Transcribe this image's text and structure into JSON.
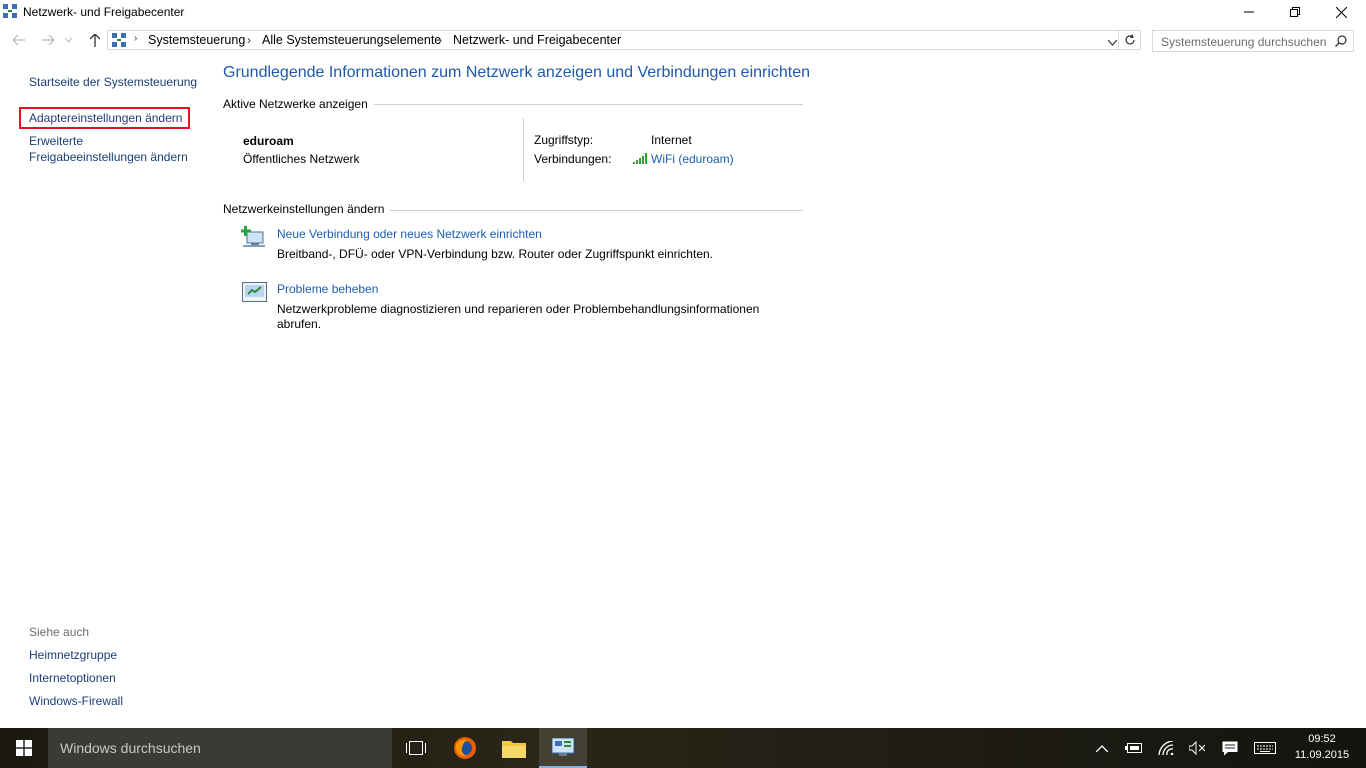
{
  "window": {
    "title": "Netzwerk- und Freigabecenter"
  },
  "address": {
    "crumbs": [
      "Systemsteuerung",
      "Alle Systemsteuerungselemente",
      "Netzwerk- und Freigabecenter"
    ],
    "search_placeholder": "Systemsteuerung durchsuchen"
  },
  "left_pane": {
    "home": "Startseite der Systemsteuerung",
    "adapter": "Adaptereinstellungen ändern",
    "advanced_line1": "Erweiterte",
    "advanced_line2": "Freigabeeinstellungen ändern",
    "see_also": "Siehe auch",
    "see_also_links": [
      "Heimnetzgruppe",
      "Internetoptionen",
      "Windows-Firewall"
    ]
  },
  "main": {
    "title": "Grundlegende Informationen zum Netzwerk anzeigen und Verbindungen einrichten",
    "active_label": "Aktive Netzwerke anzeigen",
    "network_name": "eduroam",
    "network_type": "Öffentliches Netzwerk",
    "access_type_label": "Zugriffstyp:",
    "access_type_value": "Internet",
    "connections_label": "Verbindungen:",
    "connection_value": "WiFi (eduroam)",
    "change_label": "Netzwerkeinstellungen ändern",
    "task1_title": "Neue Verbindung oder neues Netzwerk einrichten",
    "task1_desc": "Breitband-, DFÜ- oder VPN-Verbindung bzw. Router oder Zugriffspunkt einrichten.",
    "task2_title": "Probleme beheben",
    "task2_desc1": "Netzwerkprobleme diagnostizieren und reparieren oder Problembehandlungsinformationen",
    "task2_desc2": "abrufen."
  },
  "taskbar": {
    "search_placeholder": "Windows durchsuchen",
    "time": "09:52",
    "date": "11.09.2015"
  },
  "colors": {
    "accent_link": "#1a5fb4",
    "title_blue": "#1e5aa8",
    "highlight_red": "#e81123"
  }
}
